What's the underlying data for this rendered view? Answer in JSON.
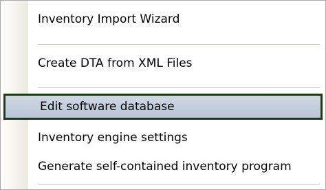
{
  "menu": {
    "items": [
      {
        "label": "Inventory Import Wizard"
      },
      {
        "label": "Create DTA from XML Files"
      },
      {
        "label": "Edit software database",
        "selected": true
      },
      {
        "label": "Inventory engine settings"
      },
      {
        "label": "Generate self-contained inventory program"
      }
    ]
  },
  "colors": {
    "selection_border": "#1c3a12",
    "selection_fill": "#b9c6d8",
    "separator": "#c5c2b8",
    "gutter": "#ebe9e1"
  }
}
